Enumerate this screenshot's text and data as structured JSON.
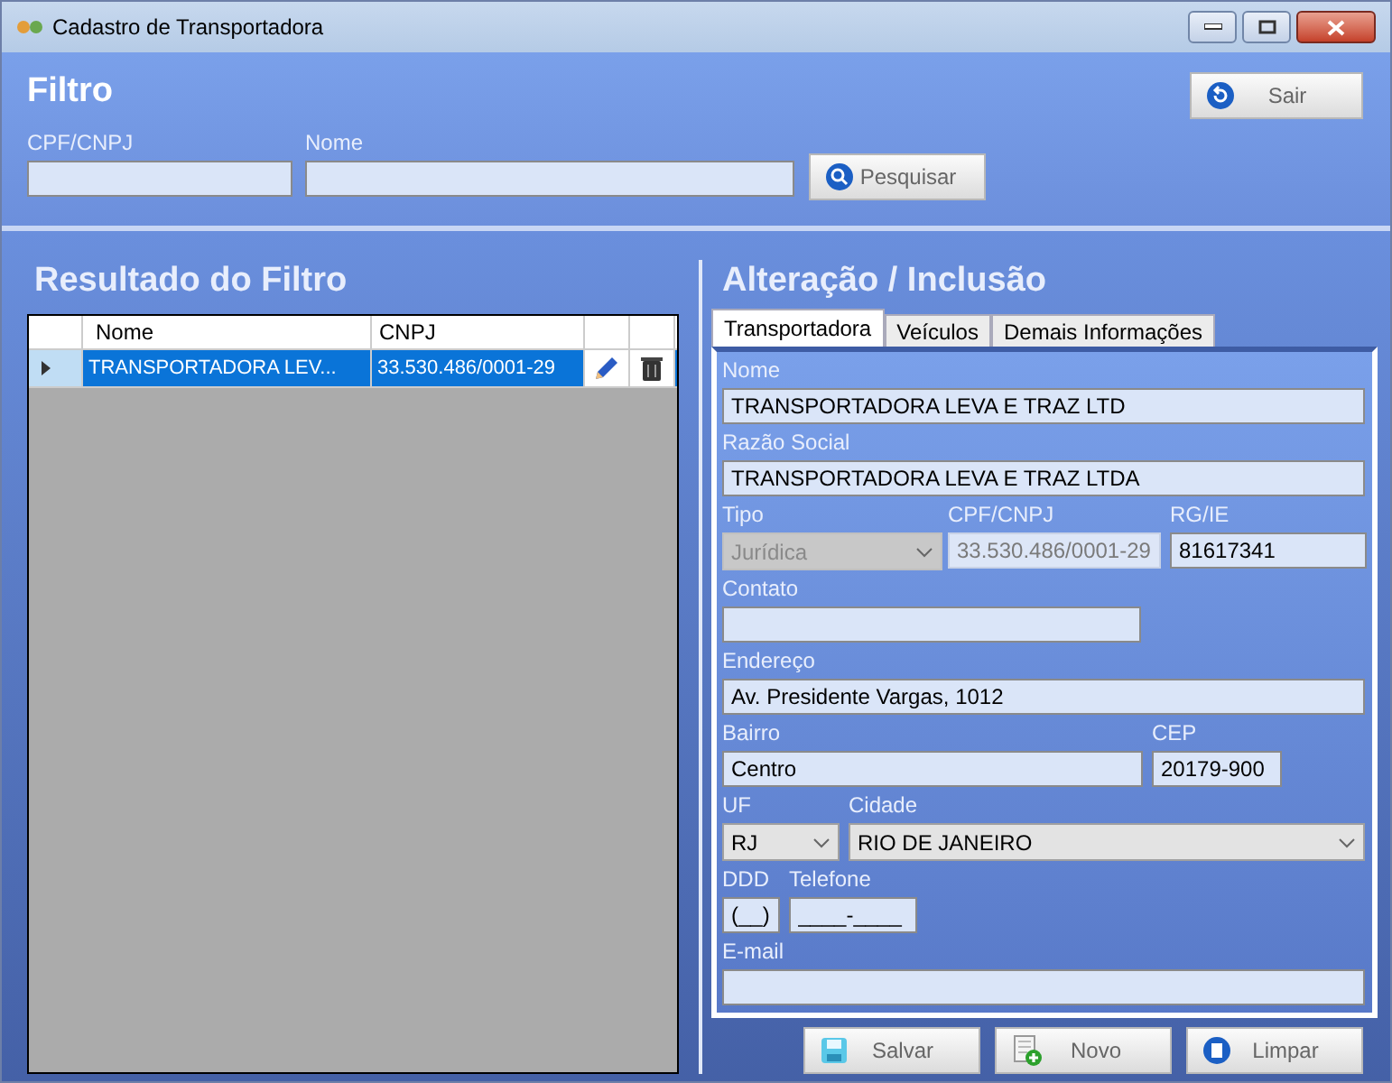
{
  "window": {
    "title": "Cadastro de Transportadora"
  },
  "filter": {
    "title": "Filtro",
    "exit_button": "Sair",
    "search_button": "Pesquisar",
    "fields": [
      {
        "label": "CPF/CNPJ"
      },
      {
        "label": "Nome"
      }
    ]
  },
  "results": {
    "title": "Resultado do Filtro",
    "columns": [
      "Nome",
      "CNPJ"
    ],
    "rows": [
      {
        "nome": "TRANSPORTADORA LEV...",
        "cnpj": "33.530.486/0001-29",
        "selected": true
      }
    ]
  },
  "edit": {
    "title": "Alteração / Inclusão",
    "tabs": [
      {
        "label": "Transportadora",
        "selected": true
      },
      {
        "label": "Veículos",
        "selected": false
      },
      {
        "label": "Demais Informações",
        "selected": false
      }
    ],
    "nome": {
      "label": "Nome",
      "value": "TRANSPORTADORA LEVA E TRAZ LTD"
    },
    "razao_social": {
      "label": "Razão Social",
      "value": "TRANSPORTADORA LEVA E TRAZ LTDA"
    },
    "tipo": {
      "label": "Tipo",
      "value": "Jurídica",
      "disabled": true
    },
    "cpf_cnpj": {
      "label": "CPF/CNPJ",
      "value": "33.530.486/0001-29",
      "disabled": true
    },
    "rg_ie": {
      "label": "RG/IE",
      "value": "81617341",
      "disabled": false
    },
    "contato": {
      "label": "Contato"
    },
    "endereco": {
      "label": "Endereço",
      "value": "Av. Presidente Vargas, 1012"
    },
    "bairro": {
      "label": "Bairro",
      "value": "Centro"
    },
    "cep": {
      "label": "CEP",
      "value": "20179-900"
    },
    "uf": {
      "label": "UF",
      "value": "RJ"
    },
    "cidade": {
      "label": "Cidade",
      "value": "RIO DE JANEIRO"
    },
    "ddd": {
      "label": "DDD",
      "value": "(__)"
    },
    "telefone": {
      "label": "Telefone",
      "value": "____-____"
    },
    "email": {
      "label": "E-mail"
    },
    "buttons": [
      {
        "label": "Salvar",
        "kind": "save"
      },
      {
        "label": "Novo",
        "kind": "new"
      },
      {
        "label": "Limpar",
        "kind": "clear"
      }
    ]
  }
}
